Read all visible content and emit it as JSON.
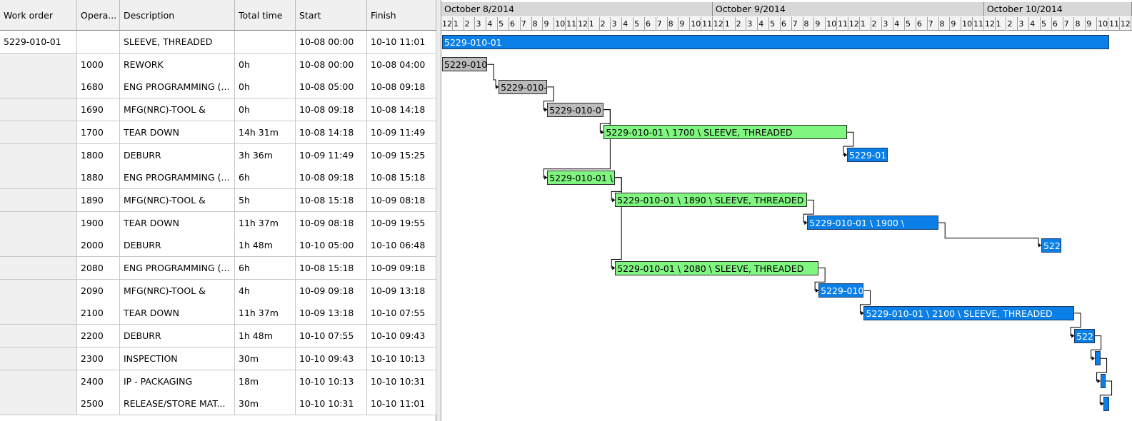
{
  "columns": [
    {
      "label": "Work order"
    },
    {
      "label": "Opera..."
    },
    {
      "label": "Description"
    },
    {
      "label": "Total time"
    },
    {
      "label": "Start"
    },
    {
      "label": "Finish"
    }
  ],
  "rows": [
    {
      "wo": "5229-010-01",
      "op": "",
      "desc": "SLEEVE, THREADED",
      "time": "",
      "start": "10-08 00:00",
      "finish": "10-10 11:01"
    },
    {
      "wo": "",
      "op": "1000",
      "desc": "REWORK",
      "time": "0h",
      "start": "10-08 00:00",
      "finish": "10-08 04:00"
    },
    {
      "wo": "",
      "op": "1680",
      "desc": "ENG PROGRAMMING (...",
      "time": "0h",
      "start": "10-08 05:00",
      "finish": "10-08 09:18"
    },
    {
      "wo": "",
      "op": "1690",
      "desc": "MFG(NRC)-TOOL &",
      "time": "0h",
      "start": "10-08 09:18",
      "finish": "10-08 14:18"
    },
    {
      "wo": "",
      "op": "1700",
      "desc": "TEAR DOWN",
      "time": "14h 31m",
      "start": "10-08 14:18",
      "finish": "10-09 11:49"
    },
    {
      "wo": "",
      "op": "1800",
      "desc": "DEBURR",
      "time": "3h 36m",
      "start": "10-09 11:49",
      "finish": "10-09 15:25"
    },
    {
      "wo": "",
      "op": "1880",
      "desc": "ENG PROGRAMMING (...",
      "time": "6h",
      "start": "10-08 09:18",
      "finish": "10-08 15:18"
    },
    {
      "wo": "",
      "op": "1890",
      "desc": "MFG(NRC)-TOOL &",
      "time": "5h",
      "start": "10-08 15:18",
      "finish": "10-09 08:18"
    },
    {
      "wo": "",
      "op": "1900",
      "desc": "TEAR DOWN",
      "time": "11h 37m",
      "start": "10-09 08:18",
      "finish": "10-09 19:55"
    },
    {
      "wo": "",
      "op": "2000",
      "desc": "DEBURR",
      "time": "1h 48m",
      "start": "10-10 05:00",
      "finish": "10-10 06:48"
    },
    {
      "wo": "",
      "op": "2080",
      "desc": "ENG PROGRAMMING (...",
      "time": "6h",
      "start": "10-08 15:18",
      "finish": "10-09 09:18"
    },
    {
      "wo": "",
      "op": "2090",
      "desc": "MFG(NRC)-TOOL &",
      "time": "4h",
      "start": "10-09 09:18",
      "finish": "10-09 13:18"
    },
    {
      "wo": "",
      "op": "2100",
      "desc": "TEAR DOWN",
      "time": "11h 37m",
      "start": "10-09 13:18",
      "finish": "10-10 07:55"
    },
    {
      "wo": "",
      "op": "2200",
      "desc": "DEBURR",
      "time": "1h 48m",
      "start": "10-10 07:55",
      "finish": "10-10 09:43"
    },
    {
      "wo": "",
      "op": "2300",
      "desc": "INSPECTION",
      "time": "30m",
      "start": "10-10 09:43",
      "finish": "10-10 10:13"
    },
    {
      "wo": "",
      "op": "2400",
      "desc": "IP - PACKAGING",
      "time": "18m",
      "start": "10-10 10:13",
      "finish": "10-10 10:31"
    },
    {
      "wo": "",
      "op": "2500",
      "desc": "RELEASE/STORE MAT...",
      "time": "30m",
      "start": "10-10 10:31",
      "finish": "10-10 11:01"
    }
  ],
  "timeline": {
    "days": [
      "October 8/2014",
      "October 9/2014",
      "October 10/2014"
    ],
    "hours": [
      "12",
      "1",
      "2",
      "3",
      "4",
      "5",
      "6",
      "7",
      "8",
      "9",
      "10",
      "11",
      "12",
      "1",
      "2",
      "3",
      "4",
      "5",
      "6",
      "7",
      "8",
      "9",
      "10",
      "11"
    ]
  },
  "bars": [
    {
      "label": "5229-010-01",
      "color": "blue"
    },
    {
      "label": "5229-010",
      "color": "gray"
    },
    {
      "label": "5229-010-",
      "color": "gray"
    },
    {
      "label": "5229-010-0",
      "color": "gray"
    },
    {
      "label": "5229-010-01 \\ 1700 \\ SLEEVE, THREADED",
      "color": "green"
    },
    {
      "label": "5229-01",
      "color": "blue"
    },
    {
      "label": "5229-010-01 \\",
      "color": "green"
    },
    {
      "label": "5229-010-01 \\ 1890 \\ SLEEVE, THREADED",
      "color": "green"
    },
    {
      "label": "5229-010-01 \\ 1900 \\",
      "color": "blue"
    },
    {
      "label": "522",
      "color": "blue"
    },
    {
      "label": "5229-010-01 \\ 2080 \\ SLEEVE, THREADED",
      "color": "green"
    },
    {
      "label": "5229-010",
      "color": "blue"
    },
    {
      "label": "5229-010-01 \\ 2100 \\ SLEEVE, THREADED",
      "color": "blue"
    },
    {
      "label": "522",
      "color": "blue"
    },
    {
      "label": "",
      "color": "blue"
    },
    {
      "label": "",
      "color": "blue"
    },
    {
      "label": "",
      "color": "blue"
    }
  ],
  "colors": {
    "blue": "#0a7fe8",
    "green": "#80f580",
    "gray": "#bcbcbc"
  }
}
